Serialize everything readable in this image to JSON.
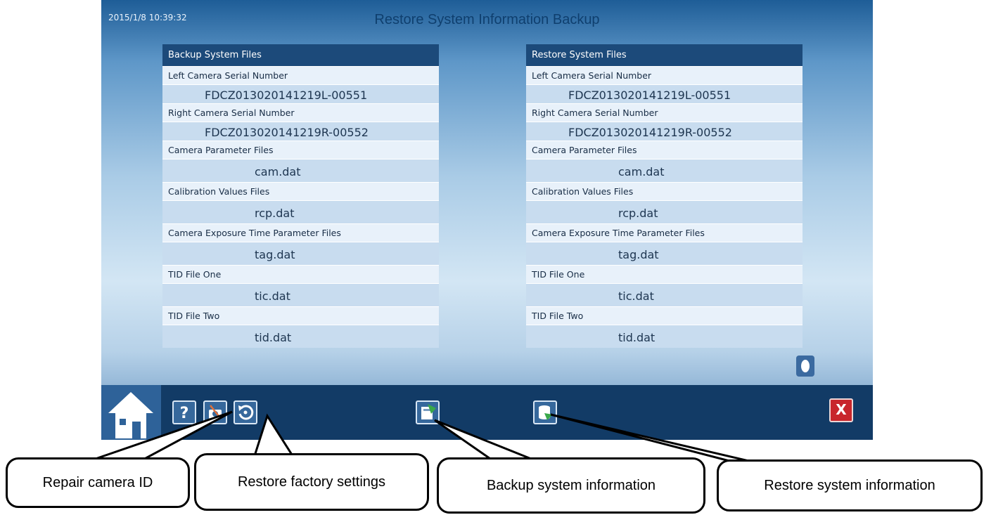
{
  "header": {
    "timestamp": "2015/1/8 10:39:32",
    "title": "Restore System Information Backup"
  },
  "backup_panel": {
    "heading": "Backup System Files",
    "items": [
      {
        "label": "Left Camera Serial Number",
        "value": "FDCZ013020141219L-00551"
      },
      {
        "label": "Right Camera Serial Number",
        "value": "FDCZ013020141219R-00552"
      },
      {
        "label": "Camera Parameter Files",
        "value": "cam.dat"
      },
      {
        "label": "Calibration Values Files",
        "value": "rcp.dat"
      },
      {
        "label": "Camera Exposure Time Parameter Files",
        "value": "tag.dat"
      },
      {
        "label": "TID File One",
        "value": "tic.dat"
      },
      {
        "label": "TID File Two",
        "value": "tid.dat"
      }
    ]
  },
  "restore_panel": {
    "heading": "Restore System Files",
    "items": [
      {
        "label": "Left Camera Serial Number",
        "value": "FDCZ013020141219L-00551"
      },
      {
        "label": "Right Camera Serial Number",
        "value": "FDCZ013020141219R-00552"
      },
      {
        "label": "Camera Parameter Files",
        "value": "cam.dat"
      },
      {
        "label": "Calibration Values Files",
        "value": "rcp.dat"
      },
      {
        "label": "Camera Exposure Time Parameter Files",
        "value": "tag.dat"
      },
      {
        "label": "TID File One",
        "value": "tic.dat"
      },
      {
        "label": "TID File Two",
        "value": "tid.dat"
      }
    ]
  },
  "toolbar": {
    "close_label": "X",
    "icons": {
      "home": "home-icon",
      "help": "help-icon",
      "repair": "repair-camera-id-icon",
      "factory": "restore-factory-icon",
      "backup": "backup-icon",
      "restore": "restore-icon"
    }
  },
  "callouts": {
    "repair": "Repair camera ID",
    "factory": "Restore factory settings",
    "backup": "Backup system information",
    "restore": "Restore system information"
  },
  "colors": {
    "header_bar": "#1c4a7a",
    "toolbar": "#123b66",
    "close": "#c8262c",
    "accent_green": "#3aa84a"
  }
}
